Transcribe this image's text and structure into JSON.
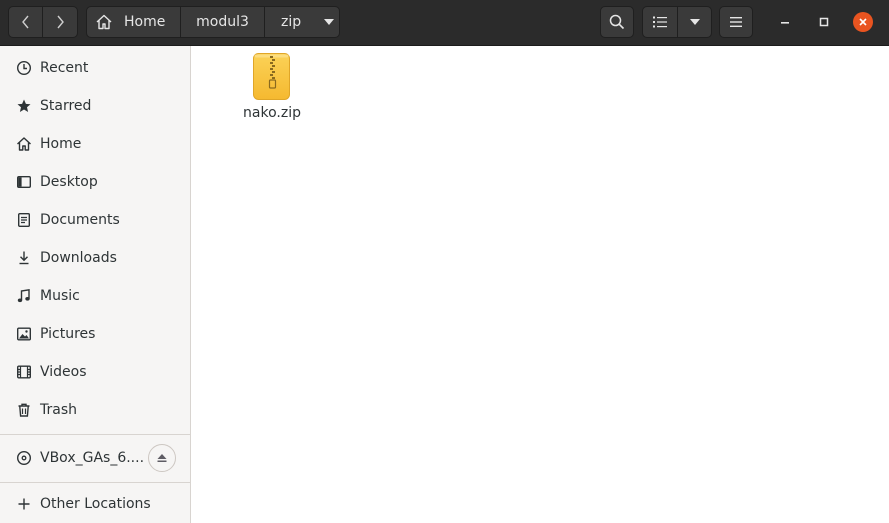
{
  "header": {
    "back_icon": "chevron-left-icon",
    "forward_icon": "chevron-right-icon",
    "path": [
      "Home",
      "modul3",
      "zip"
    ],
    "search_icon": "search-icon",
    "view_icon": "list-view-icon",
    "view_dropdown_icon": "caret-down-icon",
    "menu_icon": "hamburger-menu-icon",
    "close_color": "#e95420"
  },
  "sidebar": {
    "items": [
      {
        "label": "Recent",
        "icon": "clock-icon"
      },
      {
        "label": "Starred",
        "icon": "star-icon"
      },
      {
        "label": "Home",
        "icon": "home-icon"
      },
      {
        "label": "Desktop",
        "icon": "desktop-icon"
      },
      {
        "label": "Documents",
        "icon": "document-icon"
      },
      {
        "label": "Downloads",
        "icon": "download-icon"
      },
      {
        "label": "Music",
        "icon": "music-icon"
      },
      {
        "label": "Pictures",
        "icon": "picture-icon"
      },
      {
        "label": "Videos",
        "icon": "video-icon"
      },
      {
        "label": "Trash",
        "icon": "trash-icon"
      }
    ],
    "device": {
      "label": "VBox_GAs_6....",
      "icon": "disc-icon",
      "eject_icon": "eject-icon"
    },
    "other": {
      "label": "Other Locations",
      "icon": "plus-icon"
    }
  },
  "files": [
    {
      "name": "nako.zip",
      "icon": "zip-archive-icon",
      "icon_color": "#f9c440"
    }
  ]
}
